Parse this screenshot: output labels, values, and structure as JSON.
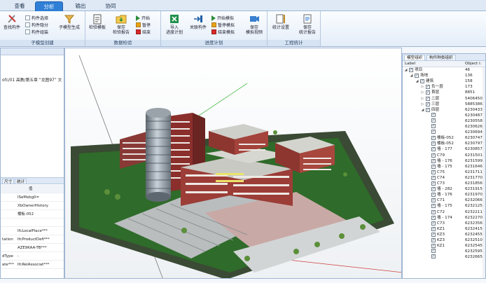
{
  "ribbon": {
    "tabs": [
      {
        "label": "查看",
        "active": false
      },
      {
        "label": "分析",
        "active": true
      },
      {
        "label": "输出",
        "active": false
      },
      {
        "label": "协同",
        "active": false
      }
    ],
    "groups": {
      "model_create": {
        "title": "子模型创建",
        "big": [
          "查找构件",
          "子模型生成"
        ],
        "small": [
          "构件选择",
          "构件隐分",
          "构件组装"
        ]
      },
      "data_check": {
        "title": "数据检验",
        "big": [
          "检验模板",
          "保存\n检验报告"
        ],
        "small": [
          "开始",
          "暂停",
          "结束"
        ]
      },
      "schedule_sim": {
        "title": "进度计划",
        "big": [
          "导入\n进度计划",
          "关联构件",
          "保存\n模拟视频"
        ],
        "small": [
          "开始模拟",
          "暂停模拟",
          "结束模拟"
        ]
      },
      "qty_stats": {
        "title": "工程统计",
        "big": [
          "统计设置",
          "保存\n统计报告"
        ]
      }
    }
  },
  "left_pane": {
    "path_text": "ofc/01 高教/第五章 “龙图97” 文",
    "prop_tabs": [
      "尺寸",
      "统计"
    ],
    "prop_header": "值",
    "props": [
      {
        "key": "",
        "value": "ISeMxbg0="
      },
      {
        "key": "",
        "value": "XbOwnerHistory"
      },
      {
        "key": "",
        "value": "楼板-052"
      },
      {
        "key": "",
        "value": ""
      },
      {
        "key": "",
        "value": "IfcLocalPlace***"
      },
      {
        "key": "tation",
        "value": "IfcProductDefi***"
      },
      {
        "key": "",
        "value": "AZE9KAA-TB***"
      },
      {
        "key": "dType",
        "value": "-"
      },
      {
        "key": "ate***",
        "value": "IfcRelAssociat***"
      }
    ]
  },
  "right_pane": {
    "tabs": [
      "模型组织",
      "构件种类组织"
    ],
    "col_label": "Label",
    "col_object": "Object i:",
    "tree": [
      {
        "level": 0,
        "exp": "-",
        "label": "项目",
        "value": "46"
      },
      {
        "level": 1,
        "exp": "-",
        "label": "场地",
        "value": "136"
      },
      {
        "level": 2,
        "exp": "-",
        "label": "建筑",
        "value": "158"
      },
      {
        "level": 3,
        "exp": "+",
        "label": "负一层",
        "value": "173"
      },
      {
        "level": 3,
        "exp": "+",
        "label": "首层",
        "value": "8851"
      },
      {
        "level": 3,
        "exp": "+",
        "label": "二层",
        "value": "5406450"
      },
      {
        "level": 3,
        "exp": "+",
        "label": "三层",
        "value": "5885386"
      },
      {
        "level": 3,
        "exp": "-",
        "label": "四层",
        "value": "6230433"
      },
      {
        "level": 4,
        "exp": "",
        "label": "",
        "value": "6230487"
      },
      {
        "level": 4,
        "exp": "",
        "label": "",
        "value": "6230558"
      },
      {
        "level": 4,
        "exp": "",
        "label": "",
        "value": "6230626"
      },
      {
        "level": 4,
        "exp": "",
        "label": "",
        "value": "6230694"
      },
      {
        "level": 4,
        "exp": "",
        "label": "楼板-052",
        "value": "6230747"
      },
      {
        "level": 4,
        "exp": "",
        "label": "楼板-052",
        "value": "6230797"
      },
      {
        "level": 4,
        "exp": "",
        "label": "墙 - 177",
        "value": "6230857"
      },
      {
        "level": 4,
        "exp": "",
        "label": "C79",
        "value": "6231501"
      },
      {
        "level": 4,
        "exp": "",
        "label": "墙 - 176",
        "value": "6231599"
      },
      {
        "level": 4,
        "exp": "",
        "label": "墙 - 175",
        "value": "6231646"
      },
      {
        "level": 4,
        "exp": "",
        "label": "C75",
        "value": "6231711"
      },
      {
        "level": 4,
        "exp": "",
        "label": "C74",
        "value": "6231770"
      },
      {
        "level": 4,
        "exp": "",
        "label": "C73",
        "value": "6231856"
      },
      {
        "level": 4,
        "exp": "",
        "label": "墙 - 282",
        "value": "6231915"
      },
      {
        "level": 4,
        "exp": "",
        "label": "墙 - 176",
        "value": "6231970"
      },
      {
        "level": 4,
        "exp": "",
        "label": "C71",
        "value": "6232066"
      },
      {
        "level": 4,
        "exp": "",
        "label": "墙 - 175",
        "value": "6232125"
      },
      {
        "level": 4,
        "exp": "",
        "label": "C72",
        "value": "6232211"
      },
      {
        "level": 4,
        "exp": "",
        "label": "墙 - 174",
        "value": "6232270"
      },
      {
        "level": 4,
        "exp": "",
        "label": "C73",
        "value": "6232356"
      },
      {
        "level": 4,
        "exp": "",
        "label": "KZ1",
        "value": "6232415"
      },
      {
        "level": 4,
        "exp": "",
        "label": "KZ3",
        "value": "6232455"
      },
      {
        "level": 4,
        "exp": "",
        "label": "KZ3",
        "value": "6232510"
      },
      {
        "level": 4,
        "exp": "",
        "label": "KZ1",
        "value": "6232545"
      },
      {
        "level": 4,
        "exp": "",
        "label": "",
        "value": "6232595"
      },
      {
        "level": 4,
        "exp": "",
        "label": "",
        "value": "6232665"
      }
    ]
  }
}
